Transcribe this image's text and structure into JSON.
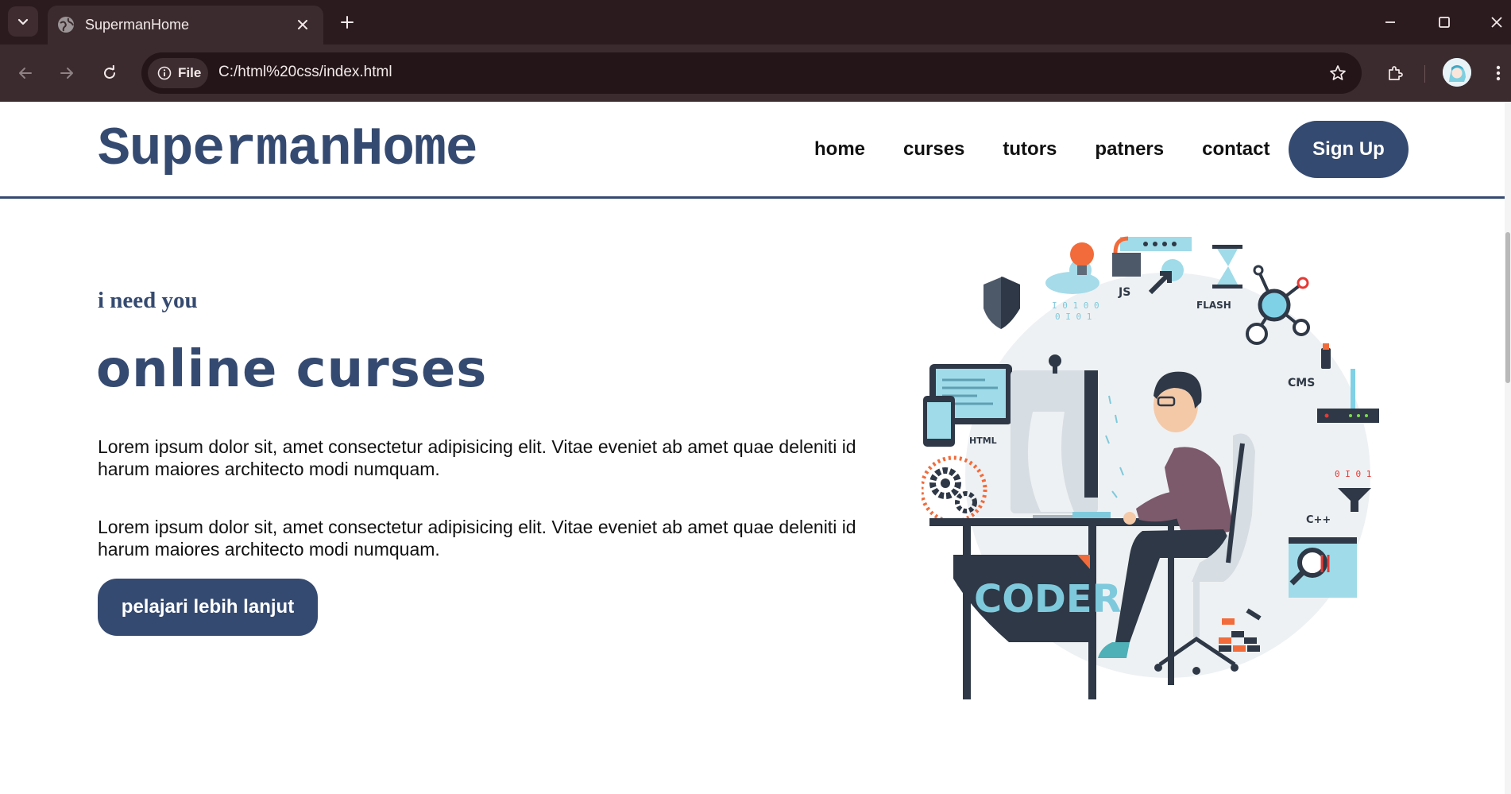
{
  "browser": {
    "tab_title": "SupermanHome",
    "site_chip_label": "File",
    "url": "C:/html%20css/index.html"
  },
  "site": {
    "logo": "SupermanHome",
    "nav": [
      "home",
      "curses",
      "tutors",
      "patners",
      "contact"
    ],
    "signup_label": "Sign Up"
  },
  "hero": {
    "subtitle": "i need you",
    "title": "online curses",
    "paragraphs": [
      "Lorem ipsum dolor sit, amet consectetur adipisicing elit. Vitae eveniet ab amet quae deleniti id harum maiores architecto modi numquam.",
      "Lorem ipsum dolor sit, amet consectetur adipisicing elit. Vitae eveniet ab amet quae deleniti id harum maiores architecto modi numquam."
    ],
    "cta_label": "pelajari lebih lanjut"
  },
  "illustration": {
    "desk_label": "CODER",
    "tech_labels": [
      "JS",
      "FLASH",
      "CMS",
      "HTML",
      "C++"
    ]
  },
  "colors": {
    "brand": "#354a70",
    "chrome_dark": "#2b1b1f",
    "chrome_toolbar": "#3b2b2e",
    "accent_orange": "#f26b3a",
    "accent_teal": "#7fd1e6"
  },
  "icons": [
    "tab-search-icon",
    "globe-favicon-icon",
    "close-icon",
    "plus-icon",
    "minimize-icon",
    "maximize-icon",
    "window-close-icon",
    "back-icon",
    "forward-icon",
    "reload-icon",
    "info-icon",
    "star-icon",
    "extensions-icon",
    "menu-dots-icon"
  ]
}
